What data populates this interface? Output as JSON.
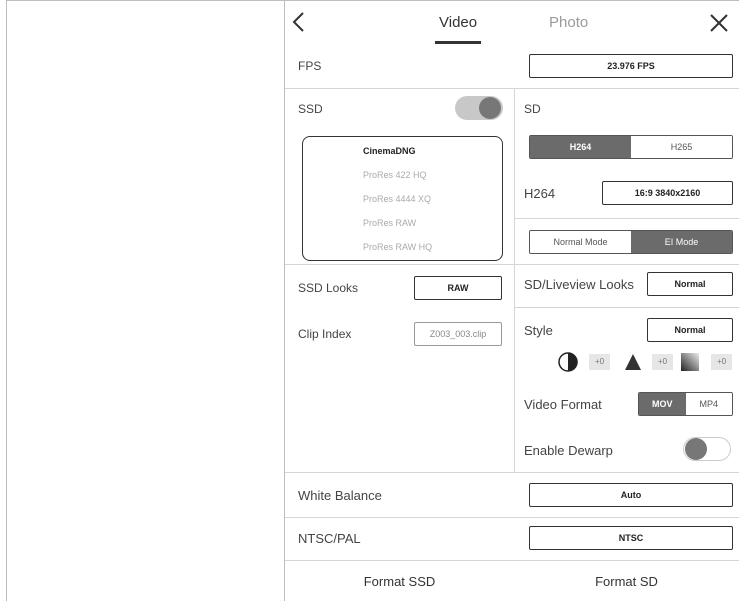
{
  "header": {
    "tabs": [
      {
        "label": "Video",
        "active": true
      },
      {
        "label": "Photo",
        "active": false
      }
    ]
  },
  "fps": {
    "label": "FPS",
    "value": "23.976 FPS"
  },
  "ssd": {
    "label": "SSD",
    "enabled": true,
    "codecs": [
      "CinemaDNG",
      "ProRes 422 HQ",
      "ProRes 4444 XQ",
      "ProRes RAW",
      "ProRes RAW HQ"
    ],
    "selected_codec": "CinemaDNG",
    "looks_label": "SSD Looks",
    "looks_value": "RAW",
    "clip_index_label": "Clip Index",
    "clip_index_value": "Z003_003.clip"
  },
  "sd": {
    "label": "SD",
    "codec_options": [
      "H264",
      "H265"
    ],
    "selected_codec": "H264",
    "resolution_label": "H264",
    "resolution_value": "16:9 3840x2160",
    "mode_options": [
      "Normal Mode",
      "EI Mode"
    ],
    "selected_mode": "EI Mode",
    "liveview_looks_label": "SD/Liveview Looks",
    "liveview_looks_value": "Normal",
    "style_label": "Style",
    "style_value": "Normal",
    "adjustments": [
      {
        "icon": "contrast-icon",
        "value": "+0"
      },
      {
        "icon": "sharpness-icon",
        "value": "+0"
      },
      {
        "icon": "saturation-icon",
        "value": "+0"
      }
    ],
    "video_format_label": "Video Format",
    "video_format_options": [
      "MOV",
      "MP4"
    ],
    "selected_video_format": "MOV",
    "dewarp_label": "Enable Dewarp",
    "dewarp_enabled": false
  },
  "white_balance": {
    "label": "White Balance",
    "value": "Auto"
  },
  "ntsc_pal": {
    "label": "NTSC/PAL",
    "value": "NTSC"
  },
  "footer": {
    "format_ssd": "Format SSD",
    "format_sd": "Format SD"
  }
}
